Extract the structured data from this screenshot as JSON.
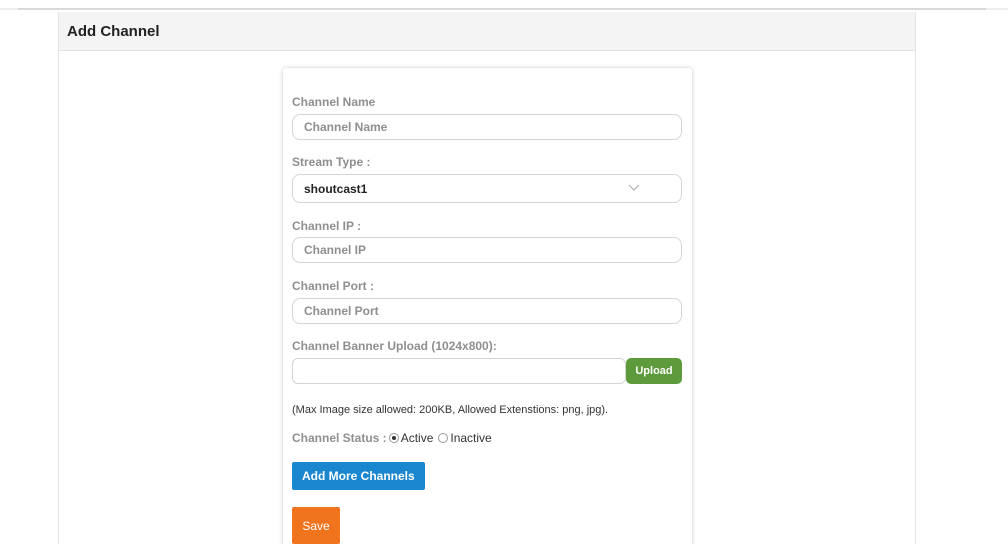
{
  "page": {
    "title": "Add Channel"
  },
  "form": {
    "channel_name": {
      "label": "Channel Name",
      "placeholder": "Channel Name",
      "value": ""
    },
    "stream_type": {
      "label": "Stream Type :",
      "selected": "shoutcast1",
      "icon": "chevron-down-icon"
    },
    "channel_ip": {
      "label": "Channel IP :",
      "placeholder": "Channel IP",
      "value": ""
    },
    "channel_port": {
      "label": "Channel Port :",
      "placeholder": "Channel Port",
      "value": ""
    },
    "banner_upload": {
      "label": "Channel Banner Upload (1024x800):",
      "button_label": "Upload",
      "note": "(Max Image size allowed: 200KB, Allowed Extenstions: png, jpg)."
    },
    "status": {
      "label": "Channel Status :",
      "options": [
        {
          "label": "Active",
          "checked": true
        },
        {
          "label": "Inactive",
          "checked": false
        }
      ]
    },
    "add_more_label": "Add More Channels",
    "save_label": "Save"
  },
  "colors": {
    "upload_button": "#5d9a3b",
    "add_more_button": "#1a86cf",
    "save_button": "#f0731d",
    "header_background": "#f4f4f4"
  }
}
